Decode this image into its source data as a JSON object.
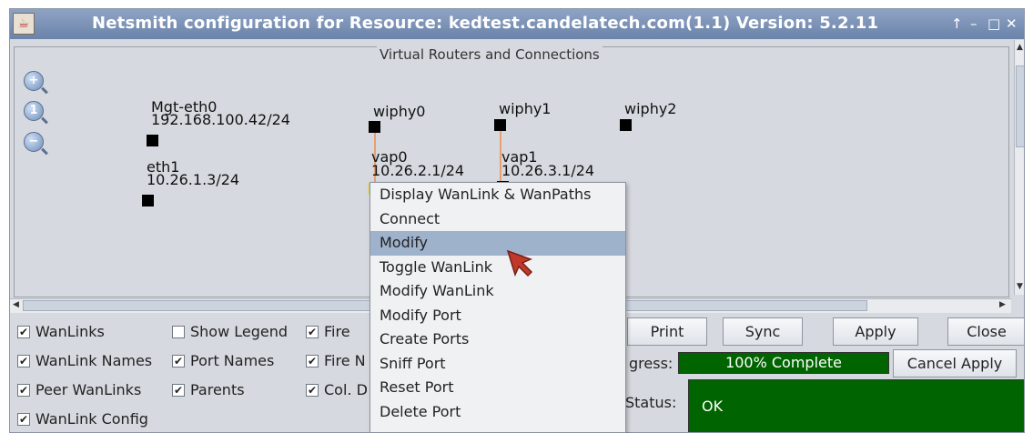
{
  "window": {
    "title": "Netsmith configuration for Resource:  kedtest.candelatech.com(1.1)  Version: 5.2.11",
    "controls": [
      "↑",
      "–",
      "□",
      "✕"
    ]
  },
  "canvas": {
    "group_title": "Virtual Routers and Connections",
    "zoom_labels": [
      "+",
      "1",
      "−"
    ],
    "nodes": {
      "mgt_name": "Mgt-eth0",
      "mgt_ip": "192.168.100.42/24",
      "eth1_name": "eth1",
      "eth1_ip": "10.26.1.3/24",
      "wiphy0": "wiphy0",
      "wiphy1": "wiphy1",
      "wiphy2": "wiphy2",
      "vap0_name": "vap0",
      "vap0_ip": "10.26.2.1/24",
      "vap1_name": "vap1",
      "vap1_ip": "10.26.3.1/24"
    }
  },
  "options": {
    "wanlinks": "WanLinks",
    "show_legend": "Show Legend",
    "fire": "Fire",
    "wanlink_names": "WanLink Names",
    "port_names": "Port Names",
    "fire_n": "Fire N",
    "peer_wanlinks": "Peer WanLinks",
    "parents": "Parents",
    "col_d": "Col. D",
    "wanlink_config": "WanLink Config"
  },
  "buttons": {
    "print": "Print",
    "sync": "Sync",
    "apply": "Apply",
    "close": "Close",
    "cancel_apply": "Cancel Apply"
  },
  "progress": {
    "label": "gress:",
    "text": "100% Complete",
    "value": 1.0
  },
  "status": {
    "label": "Status:",
    "text": "OK"
  },
  "context_menu": {
    "items": [
      "Display WanLink & WanPaths",
      "Connect",
      "Modify",
      "Toggle WanLink",
      "Modify WanLink",
      "Modify Port",
      "Create Ports",
      "Sniff Port",
      "Reset Port",
      "Delete Port"
    ],
    "highlighted": "Modify"
  }
}
